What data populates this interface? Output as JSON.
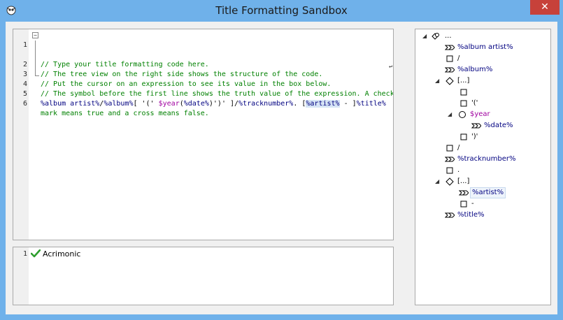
{
  "window": {
    "title": "Title Formatting Sandbox",
    "close_label": "✕",
    "colors": {
      "frame": "#6fb1ea",
      "close": "#c7413a"
    }
  },
  "editor": {
    "lines": [
      {
        "number": "1",
        "text": "// Type your title formatting code here."
      },
      {
        "number": "2",
        "text": "// The tree view on the right side shows the structure of the code."
      },
      {
        "number": "3",
        "text": "// Put the cursor on an expression to see its value in the box below."
      },
      {
        "number": "4",
        "text": "// The symbol before the first line shows the truth value of the expression. A check"
      },
      {
        "number": "",
        "text": "mark means true and a cross means false."
      },
      {
        "number": "5",
        "segments": [
          "%album artist%",
          "/",
          "%album%",
          "[ '(' ",
          "$year",
          "(",
          "%date%",
          ")",
          "')' ]",
          "/",
          "%tracknumber%",
          ". [",
          "%artist%",
          " - ]",
          "%title%"
        ]
      },
      {
        "number": "6",
        "text": ""
      }
    ],
    "wrap_marker": "↩"
  },
  "output": {
    "line_number": "1",
    "status_icon": "check-icon",
    "value": "Acrimonic"
  },
  "tree": {
    "root_label": "...",
    "nodes": [
      {
        "label": "%album artist%",
        "type": "field"
      },
      {
        "label": "/",
        "type": "text"
      },
      {
        "label": "%album%",
        "type": "field"
      },
      {
        "label": "[...]",
        "type": "conditional"
      },
      {
        "label": "",
        "type": "text"
      },
      {
        "label": "'('",
        "type": "text"
      },
      {
        "label": "$year",
        "type": "function"
      },
      {
        "label": "%date%",
        "type": "field"
      },
      {
        "label": "')'",
        "type": "text"
      },
      {
        "label": "/",
        "type": "text"
      },
      {
        "label": "%tracknumber%",
        "type": "field"
      },
      {
        "label": ".",
        "type": "text"
      },
      {
        "label": "[...]",
        "type": "conditional"
      },
      {
        "label": "%artist%",
        "type": "field",
        "selected": true
      },
      {
        "label": "-",
        "type": "text"
      },
      {
        "label": "%title%",
        "type": "field"
      }
    ]
  }
}
